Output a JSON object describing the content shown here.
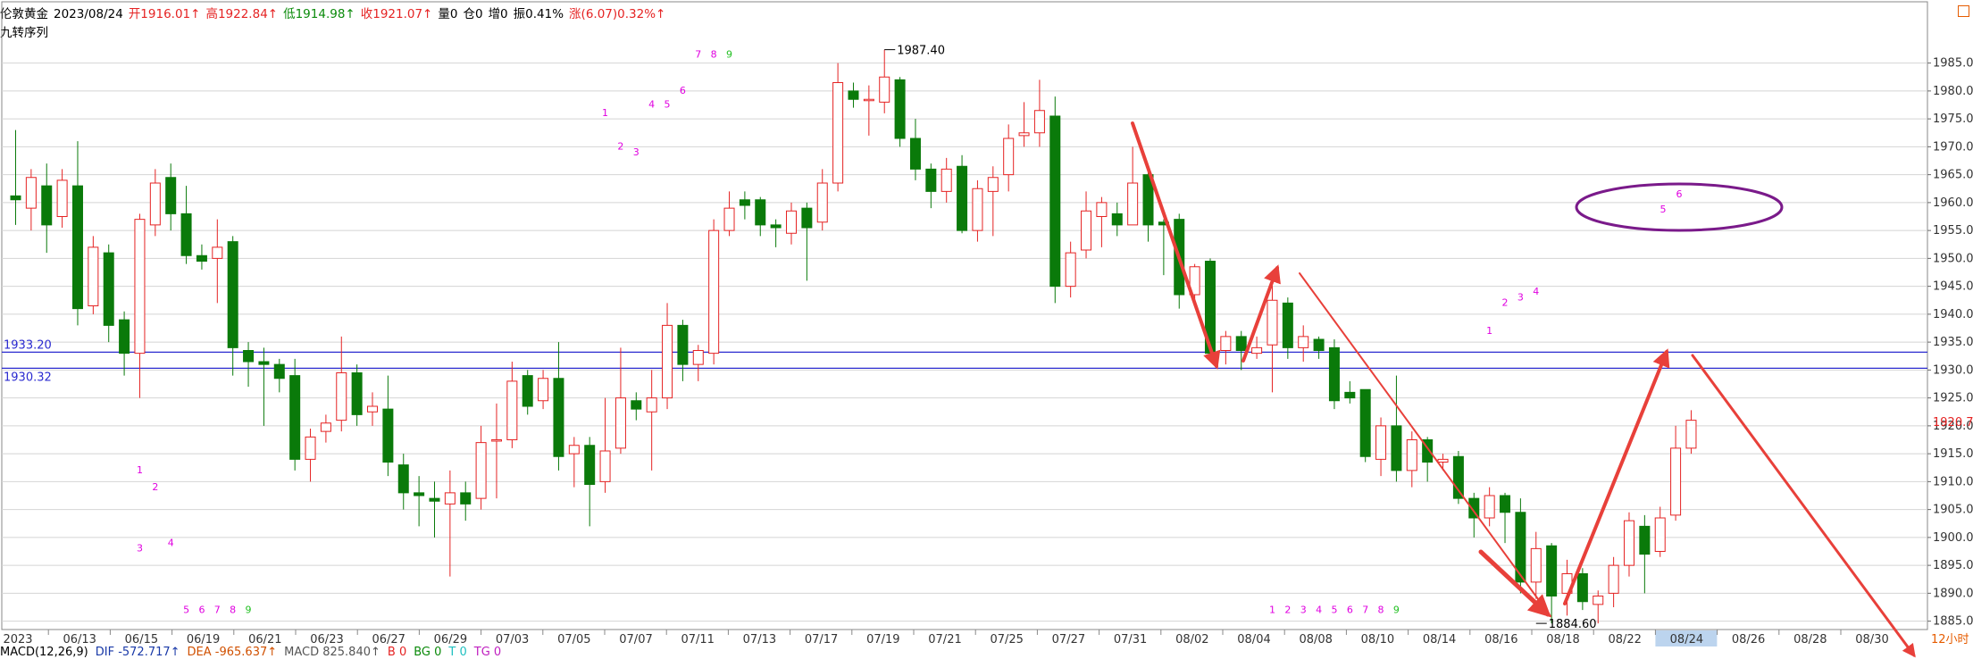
{
  "header": {
    "symbol": "伦敦黄金",
    "date": "2023/08/24",
    "open": "开1916.01↑",
    "high": "高1922.84↑",
    "low": "低1914.98↑",
    "close": "收1921.07↑",
    "volume": "量0",
    "position": "仓0",
    "increase": "增0",
    "amplitude": "振0.41%",
    "change": "涨(6.07)0.32%↑",
    "indicator_name": "九转序列"
  },
  "macd_bar": {
    "name": "MACD(12,26,9)",
    "dif": "DIF -572.717↑",
    "dea": "DEA -965.637↑",
    "macd": "MACD 825.840↑",
    "b": "B 0",
    "bg": "BG 0",
    "t": "T 0",
    "tg": "TG 0"
  },
  "period_label": "12小时",
  "colors": {
    "up": "#e52323",
    "down": "#0a7a0a",
    "grid": "#d4d4d4",
    "hline": "#2a2ad0",
    "arrow": "#e8403a",
    "ellipse": "#7a1a8a",
    "nine": "#e000e0",
    "nine_final": "#22c022",
    "axis_text": "#333333",
    "highlight_date": "#bcd4ee"
  },
  "chart_data": {
    "type": "candlestick",
    "ylim": [
      1883.5,
      1991.5
    ],
    "y_ticks": [
      1885,
      1890,
      1895,
      1900,
      1905,
      1910,
      1915,
      1920,
      1925,
      1930,
      1935,
      1940,
      1945,
      1950,
      1955,
      1960,
      1965,
      1970,
      1975,
      1980,
      1985
    ],
    "x_labels": [
      "2023",
      "06/13",
      "06/15",
      "06/19",
      "06/21",
      "06/23",
      "06/27",
      "06/29",
      "07/03",
      "07/05",
      "07/07",
      "07/11",
      "07/13",
      "07/17",
      "07/19",
      "07/21",
      "07/25",
      "07/27",
      "07/31",
      "08/02",
      "08/04",
      "08/08",
      "08/10",
      "08/14",
      "08/16",
      "08/18",
      "08/22",
      "08/24",
      "08/26",
      "08/28",
      "08/30"
    ],
    "highlight_label": "08/24",
    "candles": [
      [
        1961.2,
        1960.5,
        1973.0,
        1956.0
      ],
      [
        1959.0,
        1964.5,
        1966.0,
        1955.0
      ],
      [
        1963.0,
        1956.0,
        1967.0,
        1951.0
      ],
      [
        1957.5,
        1964.0,
        1966.0,
        1955.5
      ],
      [
        1963.0,
        1941.0,
        1971.0,
        1938.0
      ],
      [
        1941.5,
        1952.0,
        1954.0,
        1940.0
      ],
      [
        1951.0,
        1938.0,
        1952.5,
        1935.0
      ],
      [
        1939.0,
        1933.0,
        1940.5,
        1929.0
      ],
      [
        1933.0,
        1957.0,
        1958.0,
        1925.0
      ],
      [
        1956.0,
        1963.5,
        1966.0,
        1954.0
      ],
      [
        1964.5,
        1958.0,
        1967.0,
        1955.0
      ],
      [
        1958.0,
        1950.5,
        1963.0,
        1949.0
      ],
      [
        1950.5,
        1949.5,
        1952.5,
        1948.0
      ],
      [
        1950.0,
        1952.0,
        1957.0,
        1942.0
      ],
      [
        1953.0,
        1934.0,
        1954.0,
        1929.0
      ],
      [
        1933.5,
        1931.5,
        1935.0,
        1927.0
      ],
      [
        1931.5,
        1931.0,
        1934.0,
        1920.0
      ],
      [
        1931.0,
        1928.5,
        1932.0,
        1926.0
      ],
      [
        1929.0,
        1914.0,
        1932.0,
        1912.0
      ],
      [
        1914.0,
        1918.0,
        1919.5,
        1910.0
      ],
      [
        1919.0,
        1920.5,
        1922.0,
        1917.0
      ],
      [
        1921.0,
        1929.5,
        1936.0,
        1919.0
      ],
      [
        1929.5,
        1922.0,
        1931.0,
        1920.0
      ],
      [
        1922.5,
        1923.5,
        1926.0,
        1920.0
      ],
      [
        1923.0,
        1913.5,
        1929.0,
        1911.0
      ],
      [
        1913.0,
        1908.0,
        1915.0,
        1905.0
      ],
      [
        1908.0,
        1907.5,
        1911.0,
        1902.0
      ],
      [
        1907.0,
        1906.5,
        1910.0,
        1900.0
      ],
      [
        1906.0,
        1908.0,
        1912.0,
        1893.0
      ],
      [
        1908.0,
        1906.0,
        1910.0,
        1903.0
      ],
      [
        1907.0,
        1917.0,
        1920.0,
        1905.0
      ],
      [
        1917.5,
        1917.5,
        1924.0,
        1907.0
      ],
      [
        1917.5,
        1928.0,
        1931.5,
        1916.0
      ],
      [
        1929.0,
        1923.5,
        1930.0,
        1922.0
      ],
      [
        1924.5,
        1928.5,
        1930.0,
        1923.0
      ],
      [
        1928.5,
        1914.5,
        1935.0,
        1912.0
      ],
      [
        1915.0,
        1916.5,
        1918.0,
        1909.0
      ],
      [
        1916.5,
        1909.5,
        1918.0,
        1902.0
      ],
      [
        1910.0,
        1915.5,
        1925.0,
        1908.0
      ],
      [
        1916.0,
        1925.0,
        1934.0,
        1915.0
      ],
      [
        1924.5,
        1923.0,
        1926.0,
        1921.0
      ],
      [
        1922.5,
        1925.0,
        1930.0,
        1912.0
      ],
      [
        1925.0,
        1938.0,
        1942.0,
        1923.0
      ],
      [
        1938.0,
        1931.0,
        1939.0,
        1928.0
      ],
      [
        1931.0,
        1933.5,
        1934.5,
        1928.0
      ],
      [
        1933.0,
        1955.0,
        1957.0,
        1931.0
      ],
      [
        1955.0,
        1959.0,
        1962.0,
        1954.0
      ],
      [
        1960.5,
        1959.5,
        1962.0,
        1957.0
      ],
      [
        1960.5,
        1956.0,
        1961.0,
        1954.0
      ],
      [
        1956.0,
        1955.5,
        1957.0,
        1952.0
      ],
      [
        1954.5,
        1958.5,
        1960.0,
        1952.5
      ],
      [
        1959.0,
        1955.5,
        1960.0,
        1946.0
      ],
      [
        1956.5,
        1963.5,
        1966.0,
        1955.0
      ],
      [
        1963.5,
        1981.5,
        1985.0,
        1962.0
      ],
      [
        1980.0,
        1978.5,
        1981.5,
        1977.0
      ],
      [
        1978.5,
        1978.5,
        1981.0,
        1972.0
      ],
      [
        1978.0,
        1982.5,
        1987.4,
        1976.0
      ],
      [
        1982.0,
        1971.5,
        1982.5,
        1970.0
      ],
      [
        1971.5,
        1966.0,
        1975.0,
        1964.0
      ],
      [
        1966.0,
        1962.0,
        1967.0,
        1959.0
      ],
      [
        1962.0,
        1966.0,
        1968.0,
        1960.0
      ],
      [
        1966.5,
        1955.0,
        1968.5,
        1954.5
      ],
      [
        1955.0,
        1962.5,
        1964.0,
        1953.0
      ],
      [
        1962.0,
        1964.5,
        1966.5,
        1954.0
      ],
      [
        1965.0,
        1971.5,
        1974.0,
        1962.0
      ],
      [
        1972.0,
        1972.5,
        1978.0,
        1970.0
      ],
      [
        1972.5,
        1976.5,
        1982.0,
        1970.0
      ],
      [
        1975.5,
        1945.0,
        1979.0,
        1942.0
      ],
      [
        1945.0,
        1951.0,
        1953.0,
        1943.0
      ],
      [
        1951.5,
        1958.5,
        1962.0,
        1950.0
      ],
      [
        1957.5,
        1960.0,
        1961.0,
        1952.0
      ],
      [
        1958.0,
        1956.0,
        1960.0,
        1954.0
      ],
      [
        1956.0,
        1963.5,
        1970.0,
        1956.0
      ],
      [
        1965.0,
        1956.0,
        1966.0,
        1953.0
      ],
      [
        1956.5,
        1956.0,
        1957.0,
        1947.0
      ],
      [
        1957.0,
        1943.5,
        1958.0,
        1941.0
      ],
      [
        1943.5,
        1948.5,
        1949.0,
        1942.0
      ],
      [
        1949.5,
        1933.0,
        1950.0,
        1932.0
      ],
      [
        1933.5,
        1936.0,
        1937.0,
        1931.0
      ],
      [
        1936.0,
        1933.5,
        1937.0,
        1930.0
      ],
      [
        1933.0,
        1934.0,
        1936.0,
        1932.0
      ],
      [
        1934.5,
        1942.5,
        1947.0,
        1926.0
      ],
      [
        1942.0,
        1934.0,
        1943.0,
        1932.0
      ],
      [
        1934.0,
        1936.0,
        1938.0,
        1931.5
      ],
      [
        1935.5,
        1933.5,
        1936.0,
        1932.0
      ],
      [
        1934.0,
        1924.5,
        1935.5,
        1923.0
      ],
      [
        1926.0,
        1925.0,
        1928.0,
        1924.0
      ],
      [
        1926.5,
        1914.5,
        1926.5,
        1913.5
      ],
      [
        1914.0,
        1920.0,
        1921.5,
        1911.0
      ],
      [
        1920.0,
        1912.0,
        1929.0,
        1910.0
      ],
      [
        1912.0,
        1917.5,
        1919.0,
        1909.0
      ],
      [
        1917.5,
        1913.5,
        1918.0,
        1910.0
      ],
      [
        1913.5,
        1914.0,
        1915.0,
        1912.0
      ],
      [
        1914.5,
        1907.0,
        1915.5,
        1906.0
      ],
      [
        1907.0,
        1903.5,
        1908.0,
        1900.0
      ],
      [
        1903.5,
        1907.5,
        1909.0,
        1902.0
      ],
      [
        1907.5,
        1904.5,
        1908.0,
        1899.0
      ],
      [
        1904.5,
        1892.0,
        1907.0,
        1890.0
      ],
      [
        1892.0,
        1898.0,
        1901.0,
        1889.0
      ],
      [
        1898.5,
        1889.5,
        1899.0,
        1884.6
      ],
      [
        1890.0,
        1893.5,
        1896.0,
        1886.0
      ],
      [
        1893.5,
        1888.5,
        1894.5,
        1887.0
      ],
      [
        1888.0,
        1889.5,
        1890.5,
        1884.6
      ],
      [
        1890.0,
        1895.0,
        1896.5,
        1887.5
      ],
      [
        1895.0,
        1903.0,
        1904.5,
        1893.0
      ],
      [
        1902.0,
        1897.0,
        1904.0,
        1890.0
      ],
      [
        1897.5,
        1903.5,
        1905.5,
        1896.5
      ],
      [
        1904.0,
        1916.0,
        1920.0,
        1903.0
      ],
      [
        1916.0,
        1921.0,
        1922.8,
        1915.0
      ]
    ],
    "annotations": {
      "max_label": "1987.40",
      "min_label": "1884.60",
      "hline_1": "1933.20",
      "hline_2": "1930.32",
      "last_price": "1920.78",
      "ellipse_numbers": [
        "6",
        "5"
      ]
    },
    "nine_sequences": [
      {
        "labels": [
          "1",
          "2",
          "3",
          "4",
          "5",
          "6",
          "7",
          "8",
          "9"
        ],
        "xs": [
          8,
          9,
          8,
          10,
          11,
          12,
          13,
          14,
          15
        ],
        "ys": [
          1911.5,
          1908.5,
          1897.5,
          1898.5,
          1886.5,
          1886.5,
          1886.5,
          1886.5,
          1886.5
        ]
      },
      {
        "labels": [
          "1",
          "2",
          "3",
          "4",
          "5",
          "6",
          "7",
          "8",
          "9"
        ],
        "xs": [
          38,
          39,
          40,
          41,
          42,
          43,
          44,
          45,
          46
        ],
        "ys": [
          1975.5,
          1969.5,
          1968.5,
          1977.0,
          1977.0,
          1979.5,
          1986.0,
          1986.0,
          1986.0
        ]
      },
      {
        "labels": [
          "1",
          "2",
          "3",
          "4",
          "5",
          "6",
          "7",
          "8",
          "9"
        ],
        "xs": [
          81,
          82,
          83,
          84,
          85,
          86,
          87,
          88,
          89
        ],
        "ys": [
          1886.5,
          1886.5,
          1886.5,
          1886.5,
          1886.5,
          1886.5,
          1886.5,
          1886.5,
          1886.5
        ]
      },
      {
        "labels": [
          "1",
          "2",
          "3",
          "4"
        ],
        "xs": [
          95,
          96,
          97,
          98
        ],
        "ys": [
          1936.5,
          1941.5,
          1942.5,
          1943.5
        ]
      }
    ]
  }
}
